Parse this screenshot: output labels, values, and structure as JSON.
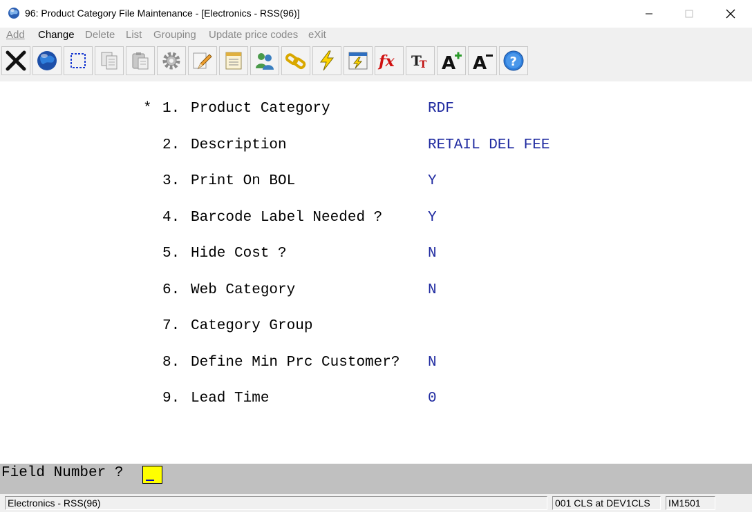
{
  "window": {
    "title": "96: Product Category File Maintenance - [Electronics - RSS(96)]",
    "icon": "globe-icon"
  },
  "menu": [
    {
      "label": "Add",
      "active": false
    },
    {
      "label": "Change",
      "active": true
    },
    {
      "label": "Delete",
      "active": false
    },
    {
      "label": "List",
      "active": false
    },
    {
      "label": "Grouping",
      "active": false
    },
    {
      "label": "Update price codes",
      "active": false
    },
    {
      "label": "eXit",
      "active": false
    }
  ],
  "toolbar": [
    "close-x-icon",
    "globe-icon",
    "select-box-icon",
    "copy-icon",
    "paste-icon",
    "settings-gear-icon",
    "edit-pencil-icon",
    "notepad-icon",
    "users-icon",
    "link-chain-icon",
    "lightning-icon",
    "calculator-icon",
    "function-fx-icon",
    "text-size-icon",
    "font-increase-icon",
    "font-decrease-icon",
    "help-icon"
  ],
  "fields": [
    {
      "mark": "*",
      "num": "1.",
      "label": "Product Category",
      "value": "RDF"
    },
    {
      "mark": "",
      "num": "2.",
      "label": "Description",
      "value": "RETAIL DEL FEE"
    },
    {
      "mark": "",
      "num": "3.",
      "label": "Print On BOL",
      "value": "Y"
    },
    {
      "mark": "",
      "num": "4.",
      "label": "Barcode Label Needed ?",
      "value": "Y"
    },
    {
      "mark": "",
      "num": "5.",
      "label": "Hide Cost ?",
      "value": "N"
    },
    {
      "mark": "",
      "num": "6.",
      "label": "Web Category",
      "value": "N"
    },
    {
      "mark": "",
      "num": "7.",
      "label": "Category Group",
      "value": ""
    },
    {
      "mark": "",
      "num": "8.",
      "label": "Define Min Prc Customer?",
      "value": "N"
    },
    {
      "mark": "",
      "num": "9.",
      "label": "Lead Time",
      "value": "0"
    }
  ],
  "prompt": {
    "label": "Field Number ?",
    "value": ""
  },
  "status": {
    "company": "Electronics - RSS(96)",
    "session": "001 CLS at DEV1CLS",
    "program": "IM1501"
  },
  "colors": {
    "value_text": "#1f2aa0",
    "prompt_bar": "#c0c0c0",
    "input_highlight": "#ffff00"
  }
}
